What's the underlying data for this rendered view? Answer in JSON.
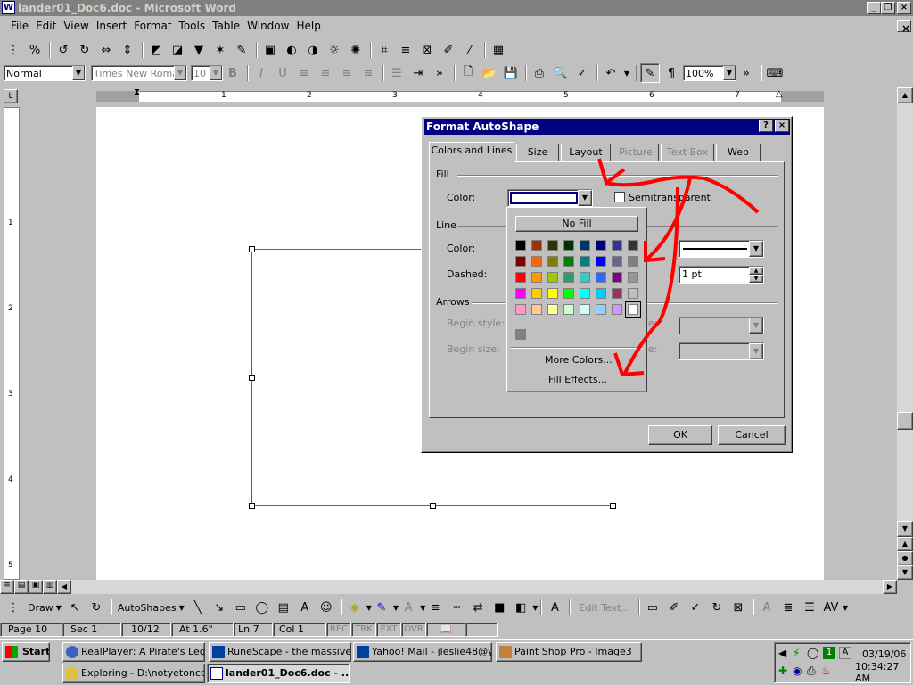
{
  "window": {
    "title": "lander01_Doc6.doc - Microsoft Word",
    "app_icon": "word-icon"
  },
  "menu": [
    "File",
    "Edit",
    "View",
    "Insert",
    "Format",
    "Tools",
    "Table",
    "Window",
    "Help"
  ],
  "format_toolbar": {
    "style": "Normal",
    "font": "Times New Roman",
    "size": "10",
    "zoom": "100%"
  },
  "ruler_numbers": [
    "1",
    "2",
    "3",
    "4",
    "5",
    "6",
    "7"
  ],
  "vruler_numbers": [
    "1",
    "2",
    "3",
    "4",
    "5"
  ],
  "dialog": {
    "title": "Format AutoShape",
    "help": "?",
    "close": "×",
    "tabs": [
      {
        "label": "Colors and Lines",
        "active": true,
        "enabled": true
      },
      {
        "label": "Size",
        "enabled": true
      },
      {
        "label": "Layout",
        "enabled": true
      },
      {
        "label": "Picture",
        "enabled": false
      },
      {
        "label": "Text Box",
        "enabled": false
      },
      {
        "label": "Web",
        "enabled": true
      }
    ],
    "fill": {
      "section": "Fill",
      "color_label": "Color:",
      "semitransparent": "Semitransparent"
    },
    "line": {
      "section": "Line",
      "color_label": "Color:",
      "dashed_label": "Dashed:",
      "weight": "1 pt"
    },
    "arrows": {
      "section": "Arrows",
      "begin_style": "Begin style:",
      "begin_size": "Begin size:",
      "end_style": "e:",
      "end_size": "e:"
    },
    "ok": "OK",
    "cancel": "Cancel",
    "palette": {
      "no_fill": "No Fill",
      "more_colors": "More Colors...",
      "fill_effects": "Fill Effects...",
      "rows": [
        [
          "#000000",
          "#993300",
          "#333300",
          "#003300",
          "#003366",
          "#000080",
          "#333399",
          "#333333"
        ],
        [
          "#800000",
          "#FF6600",
          "#808000",
          "#008000",
          "#008080",
          "#0000FF",
          "#666699",
          "#808080"
        ],
        [
          "#FF0000",
          "#FF9900",
          "#99CC00",
          "#339966",
          "#33CCCC",
          "#3366FF",
          "#800080",
          "#969696"
        ],
        [
          "#FF00FF",
          "#FFCC00",
          "#FFFF00",
          "#00FF00",
          "#00FFFF",
          "#00CCFF",
          "#993366",
          "#C0C0C0"
        ],
        [
          "#FF99CC",
          "#FFCC99",
          "#FFFF99",
          "#CCFFCC",
          "#CCFFFF",
          "#99CCFF",
          "#CC99FF",
          "#FFFFFF"
        ]
      ],
      "recent": "#808080"
    }
  },
  "drawing_toolbar": {
    "draw": "Draw",
    "autoshapes": "AutoShapes",
    "edit_text": "Edit Text..."
  },
  "status": {
    "page": "Page 10",
    "sec": "Sec 1",
    "pages": "10/12",
    "at": "At 1.6\"",
    "ln": "Ln 7",
    "col": "Col 1",
    "rec": "REC",
    "trk": "TRK",
    "ext": "EXT",
    "ovr": "OVR"
  },
  "taskbar": {
    "start": "Start",
    "tasks": [
      "RealPlayer: A Pirate's Leg...",
      "RuneScape - the massive ...",
      "Yahoo! Mail - jleslie48@ya...",
      "Paint Shop Pro - Image3",
      "Exploring - D:\\notyetoncd\\...",
      "lander01_Doc6.doc - ..."
    ],
    "date": "03/19/06",
    "time": "10:34:27 AM",
    "tray_number": "1",
    "tray_letter": "A"
  },
  "colors": {
    "title_active": "#000080",
    "annotation": "#ff0000"
  }
}
